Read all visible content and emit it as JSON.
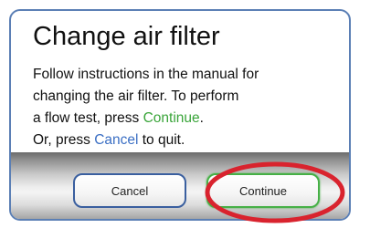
{
  "dialog": {
    "title": "Change air filter",
    "body": {
      "line1": "Follow instructions in the manual for",
      "line2": "changing the air filter.  To perform",
      "line3_prefix": "a flow test, press ",
      "line3_keyword": "Continue",
      "line3_suffix": ".",
      "line4_prefix": "Or, press ",
      "line4_keyword": "Cancel",
      "line4_suffix": " to quit."
    },
    "buttons": {
      "cancel_label": "Cancel",
      "continue_label": "Continue"
    }
  },
  "colors": {
    "border": "#5b7fb5",
    "continue_accent": "#3aa53a",
    "cancel_accent": "#3b6fc4",
    "highlight_ring": "#d9232e"
  }
}
